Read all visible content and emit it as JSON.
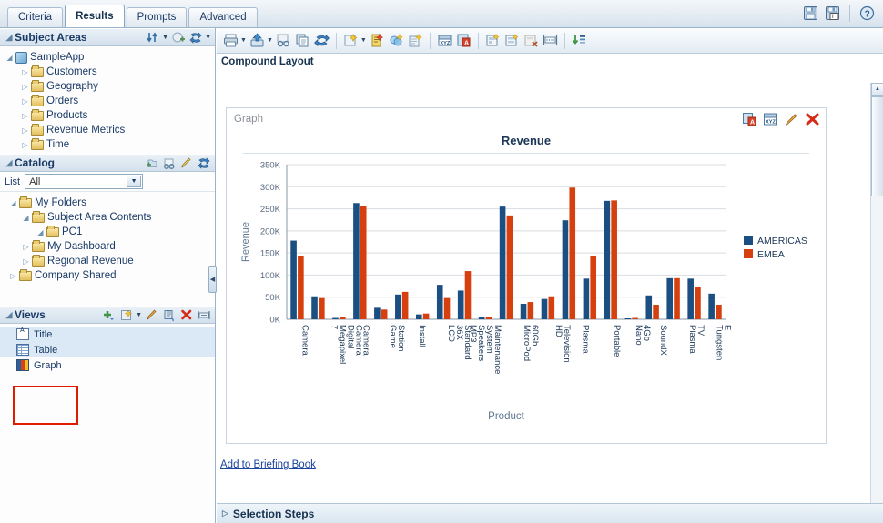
{
  "app": {
    "tabs": [
      {
        "label": "Criteria",
        "active": false
      },
      {
        "label": "Results",
        "active": true
      },
      {
        "label": "Prompts",
        "active": false
      },
      {
        "label": "Advanced",
        "active": false
      }
    ],
    "top_icons": [
      "save-icon",
      "save-as-icon",
      "help-icon"
    ]
  },
  "sidebar": {
    "subject_areas": {
      "title": "Subject Areas",
      "tools": [
        "sort-icon",
        "refresh-add-icon",
        "sync-icon"
      ],
      "root": "SampleApp",
      "folders": [
        "Customers",
        "Geography",
        "Orders",
        "Products",
        "Revenue Metrics",
        "Time"
      ]
    },
    "catalog": {
      "title": "Catalog",
      "tools": [
        "new-folder-icon",
        "browse-icon",
        "edit-icon",
        "sync-icon"
      ],
      "list_label": "List",
      "list_value": "All",
      "tree": [
        {
          "label": "My Folders",
          "depth": 0,
          "expanded": true
        },
        {
          "label": "Subject Area Contents",
          "depth": 1,
          "expanded": true
        },
        {
          "label": "PC1",
          "depth": 2,
          "expanded": true
        },
        {
          "label": "My Dashboard",
          "depth": 1,
          "expanded": false
        },
        {
          "label": "Regional Revenue",
          "depth": 1,
          "expanded": false
        },
        {
          "label": "Company Shared",
          "depth": 0,
          "expanded": false
        }
      ]
    },
    "views": {
      "title": "Views",
      "tools": [
        "add-view-icon",
        "new-view-icon",
        "edit-view-icon",
        "duplicate-view-icon",
        "delete-view-icon",
        "view-properties-icon"
      ],
      "items": [
        {
          "label": "Title",
          "icon": "title-view-icon",
          "highlighted": true
        },
        {
          "label": "Table",
          "icon": "table-view-icon",
          "highlighted": true
        },
        {
          "label": "Graph",
          "icon": "graph-view-icon",
          "highlighted": false
        }
      ],
      "selection_color": "#e01b00"
    }
  },
  "main": {
    "toolbar_icons": [
      "print-icon",
      "export-icon",
      "preview-icon",
      "copy-icon",
      "refresh-icon",
      "new-view-icon",
      "edit-prompt-icon",
      "filter-icon",
      "calculated-item-icon",
      "column-selector-icon",
      "view-selector-icon",
      "logical-sql-icon",
      "new-group-icon",
      "new-calc-item-icon",
      "remove-group-icon",
      "measure-icon",
      "sort-icon"
    ],
    "layout_title": "Compound Layout",
    "graph_panel": {
      "label": "Graph",
      "tools": [
        "format-icon",
        "properties-icon",
        "edit-icon",
        "delete-icon"
      ]
    },
    "briefing_link": "Add to Briefing Book",
    "selection_steps": "Selection Steps"
  },
  "chart_data": {
    "type": "bar",
    "title": "Revenue",
    "xlabel": "Product",
    "ylabel": "Revenue",
    "ylim": [
      0,
      350000
    ],
    "yticks": [
      0,
      50000,
      100000,
      150000,
      200000,
      250000,
      300000,
      350000
    ],
    "ytick_labels": [
      "0K",
      "50K",
      "100K",
      "150K",
      "200K",
      "250K",
      "300K",
      "350K"
    ],
    "grid": true,
    "legend_position": "right",
    "categories": [
      "Camera",
      "7 Megapixel Digital Camera",
      "Camera",
      "Game Station",
      "Install",
      "LCD 36X Standard",
      "MP3 Speakers System",
      "Maintenance",
      "MicroPod 60Gb",
      "HD Television",
      "Plasma",
      "Portable",
      "Nano 4Gb",
      "SoundX",
      "Plasma TV",
      "Tungsten E"
    ],
    "series": [
      {
        "name": "AMERICAS",
        "color": "#1b4f82",
        "values": [
          178000,
          52000,
          3000,
          263000,
          26000,
          56000,
          11000,
          78000,
          65000,
          6000,
          255000,
          35000,
          46000,
          224000,
          92000,
          268000,
          2000,
          54000,
          93000,
          92000,
          58000
        ]
      },
      {
        "name": "EMEA",
        "color": "#d6400f",
        "values": [
          144000,
          48000,
          6000,
          256000,
          22000,
          62000,
          13000,
          48000,
          109000,
          6000,
          235000,
          39000,
          52000,
          298000,
          143000,
          269000,
          3000,
          33000,
          93000,
          74000,
          33000
        ]
      }
    ]
  }
}
